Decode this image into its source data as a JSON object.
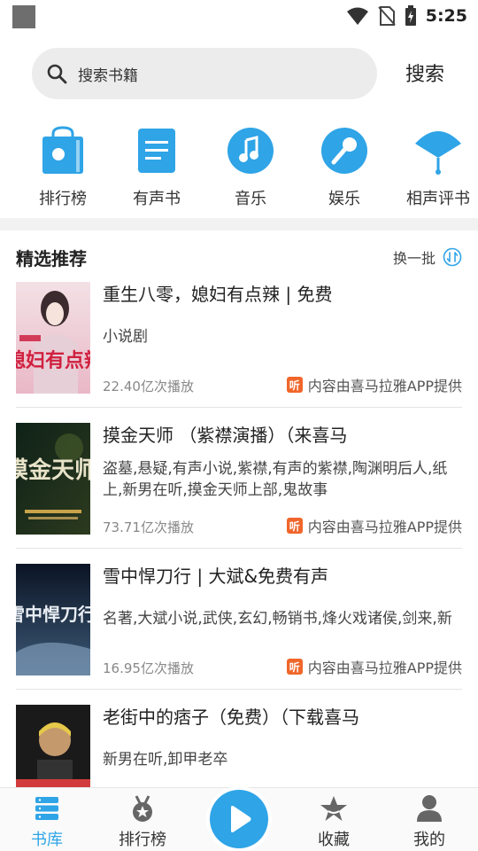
{
  "status_bar": {
    "time": "5:25"
  },
  "search": {
    "placeholder": "搜索书籍",
    "button_label": "搜索"
  },
  "categories": [
    {
      "label": "排行榜",
      "icon": "shopping-bag-icon"
    },
    {
      "label": "有声书",
      "icon": "document-icon"
    },
    {
      "label": "音乐",
      "icon": "music-note-icon"
    },
    {
      "label": "娱乐",
      "icon": "microphone-icon"
    },
    {
      "label": "相声评书",
      "icon": "fan-icon"
    }
  ],
  "section": {
    "title": "精选推荐",
    "refresh_label": "换一批"
  },
  "items": [
    {
      "title": "重生八零，媳妇有点辣 | 免费",
      "desc": "小说剧",
      "plays": "22.40亿次播放",
      "source": "内容由喜马拉雅APP提供",
      "cover_text": "媳妇有点辣"
    },
    {
      "title": "摸金天师 （紫襟演播）（来喜马",
      "desc": "盗墓,悬疑,有声小说,紫襟,有声的紫襟,陶渊明后人,纸上,新男在听,摸金天师上部,鬼故事",
      "plays": "73.71亿次播放",
      "source": "内容由喜马拉雅APP提供",
      "cover_text": "摸金天师"
    },
    {
      "title": "雪中悍刀行 | 大斌&免费有声",
      "desc": "名著,大斌小说,武侠,玄幻,畅销书,烽火戏诸侯,剑来,新",
      "plays": "16.95亿次播放",
      "source": "内容由喜马拉雅APP提供",
      "cover_text": "雪中悍刀行"
    },
    {
      "title": "老街中的痞子（免费）（下载喜马",
      "desc": "新男在听,卸甲老卒",
      "plays": "",
      "source": "",
      "cover_text": ""
    }
  ],
  "bottom_nav": [
    {
      "label": "书库",
      "icon": "stack-icon",
      "active": true
    },
    {
      "label": "排行榜",
      "icon": "medal-icon",
      "active": false
    },
    {
      "label": "收藏",
      "icon": "star-icon",
      "active": false
    },
    {
      "label": "我的",
      "icon": "person-icon",
      "active": false
    }
  ],
  "colors": {
    "accent": "#2fa4e7",
    "source_badge": "#f0662a"
  }
}
